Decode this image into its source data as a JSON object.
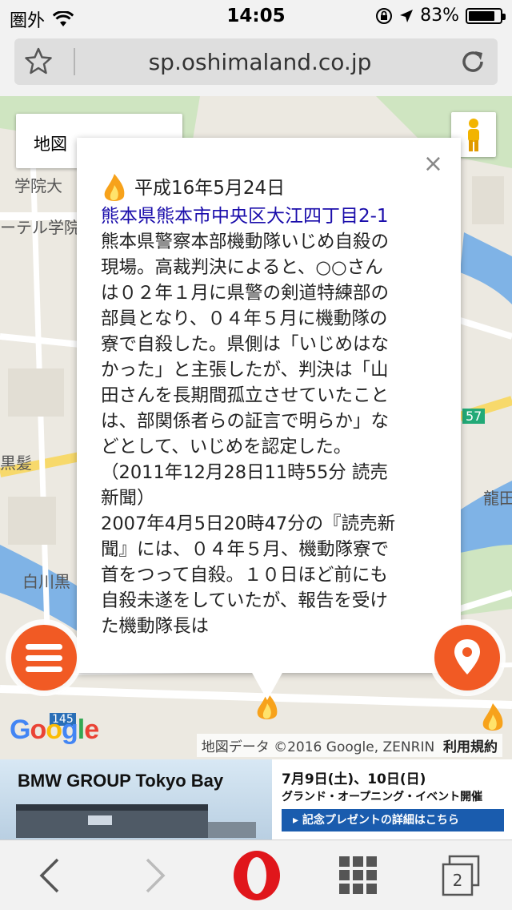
{
  "status_bar": {
    "carrier": "圏外",
    "time": "14:05",
    "battery_percent": "83%",
    "battery_level": 0.83
  },
  "url_bar": {
    "url": "sp.oshimaland.co.jp"
  },
  "map": {
    "map_type_label": "地図",
    "labels": {
      "top1": "",
      "gakuin": "学院大",
      "hotel": "ーテル学院",
      "kurokami": "黒髪",
      "shirakawa": "白川黒",
      "tatsuta": "龍田",
      "ri": "",
      "route": "57",
      "route2": "145"
    },
    "google": [
      "G",
      "o",
      "o",
      "g",
      "l",
      "e"
    ],
    "attribution": "地図データ ©2016 Google, ZENRIN",
    "terms": "利用規約"
  },
  "info_window": {
    "close": "×",
    "date": "平成16年5月24日",
    "address": "熊本県熊本市中央区大江四丁目2-1",
    "body": "熊本県警察本部機動隊いじめ自殺の現場。高裁判決によると、○○さんは０２年１月に県警の剣道特練部の部員となり、０４年５月に機動隊の寮で自殺した。県側は「いじめはなかった」と主張したが、判決は「山田さんを長期間孤立させていたことは、部関係者らの証言で明らか」などとして、いじめを認定した。（2011年12月28日11時55分 読売新聞）\n2007年4月5日20時47分の『読売新聞』には、０４年５月、機動隊寮で首をつって自殺。１０日ほど前にも自殺未遂をしていたが、報告を受けた機動隊長は"
  },
  "ad": {
    "title": "BMW GROUP Tokyo Bay",
    "date": "7月9日(土)、10日(日)",
    "subtitle": "グランド・オープニング・イベント開催",
    "button": "記念プレゼントの詳細はこちら"
  },
  "toolbar": {
    "tab_count": "2"
  },
  "colors": {
    "accent_orange": "#f15a24",
    "link_blue": "#1a0dab",
    "water": "#7fb3e6"
  }
}
